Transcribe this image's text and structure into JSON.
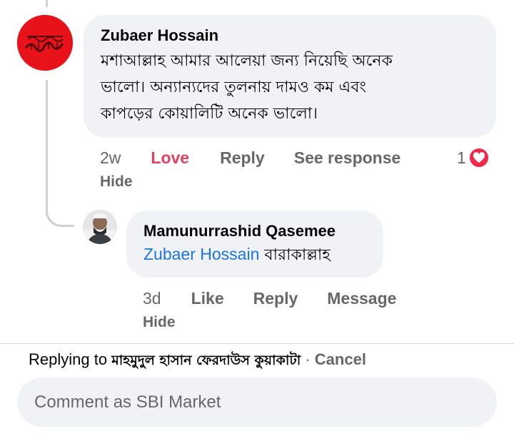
{
  "comments": [
    {
      "author": "Zubaer Hossain",
      "lines": [
        "মশাআল্লাহ আমার আলেয়া জন্য নিয়েছি অনেক",
        "ভালো। অন্যান্যদের তুলনায় দামও কম এবং",
        "কাপড়ের কোয়ালিটি অনেক ভালো।"
      ],
      "time": "2w",
      "love_label": "Love",
      "reply_label": "Reply",
      "see_response_label": "See response",
      "reaction_count": "1",
      "reaction_icon": "heart-icon",
      "hide_label": "Hide",
      "colors": {
        "love": "#e4405f",
        "avatar_bg": "#e8121b"
      }
    },
    {
      "author": "Mamunurrashid Qasemee",
      "mention": "Zubaer Hossain",
      "text": "বারাকাল্লাহ",
      "time": "3d",
      "like_label": "Like",
      "reply_label": "Reply",
      "message_label": "Message",
      "hide_label": "Hide",
      "colors": {
        "mention": "#1b74e4"
      }
    }
  ],
  "reply_bar": {
    "prefix": "Replying to",
    "target_name": "মাহমুদুল হাসান ফেরদাউস কুয়াকাটা",
    "separator": "·",
    "cancel_label": "Cancel",
    "placeholder": "Comment as SBI Market"
  }
}
